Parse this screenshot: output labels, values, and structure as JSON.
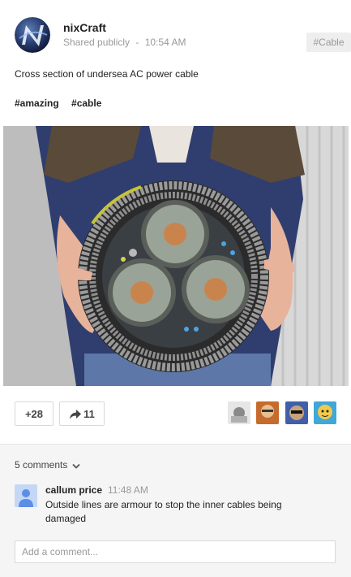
{
  "post": {
    "author": "nixCraft",
    "visibility": "Shared publicly",
    "separator": "-",
    "time": "10:54 AM",
    "tag_chip": "#Cable",
    "text": "Cross section of undersea AC power cable",
    "hashtags": [
      "#amazing",
      "#cable"
    ]
  },
  "actions": {
    "plus_label": "+28",
    "share_count": "11"
  },
  "comments": {
    "count_label": "5 comments",
    "items": [
      {
        "author": "callum price",
        "time": "11:48 AM",
        "text": "Outside lines are armour to stop the inner cables being damaged"
      }
    ],
    "input_placeholder": "Add a comment..."
  },
  "colors": {
    "comments_bg": "#f5f5f5",
    "meta_text": "#999999",
    "border": "#d9d9d9"
  },
  "icons": {
    "share": "share-arrow-icon",
    "expand": "chevron-down-icon",
    "default_avatar": "person-icon"
  }
}
